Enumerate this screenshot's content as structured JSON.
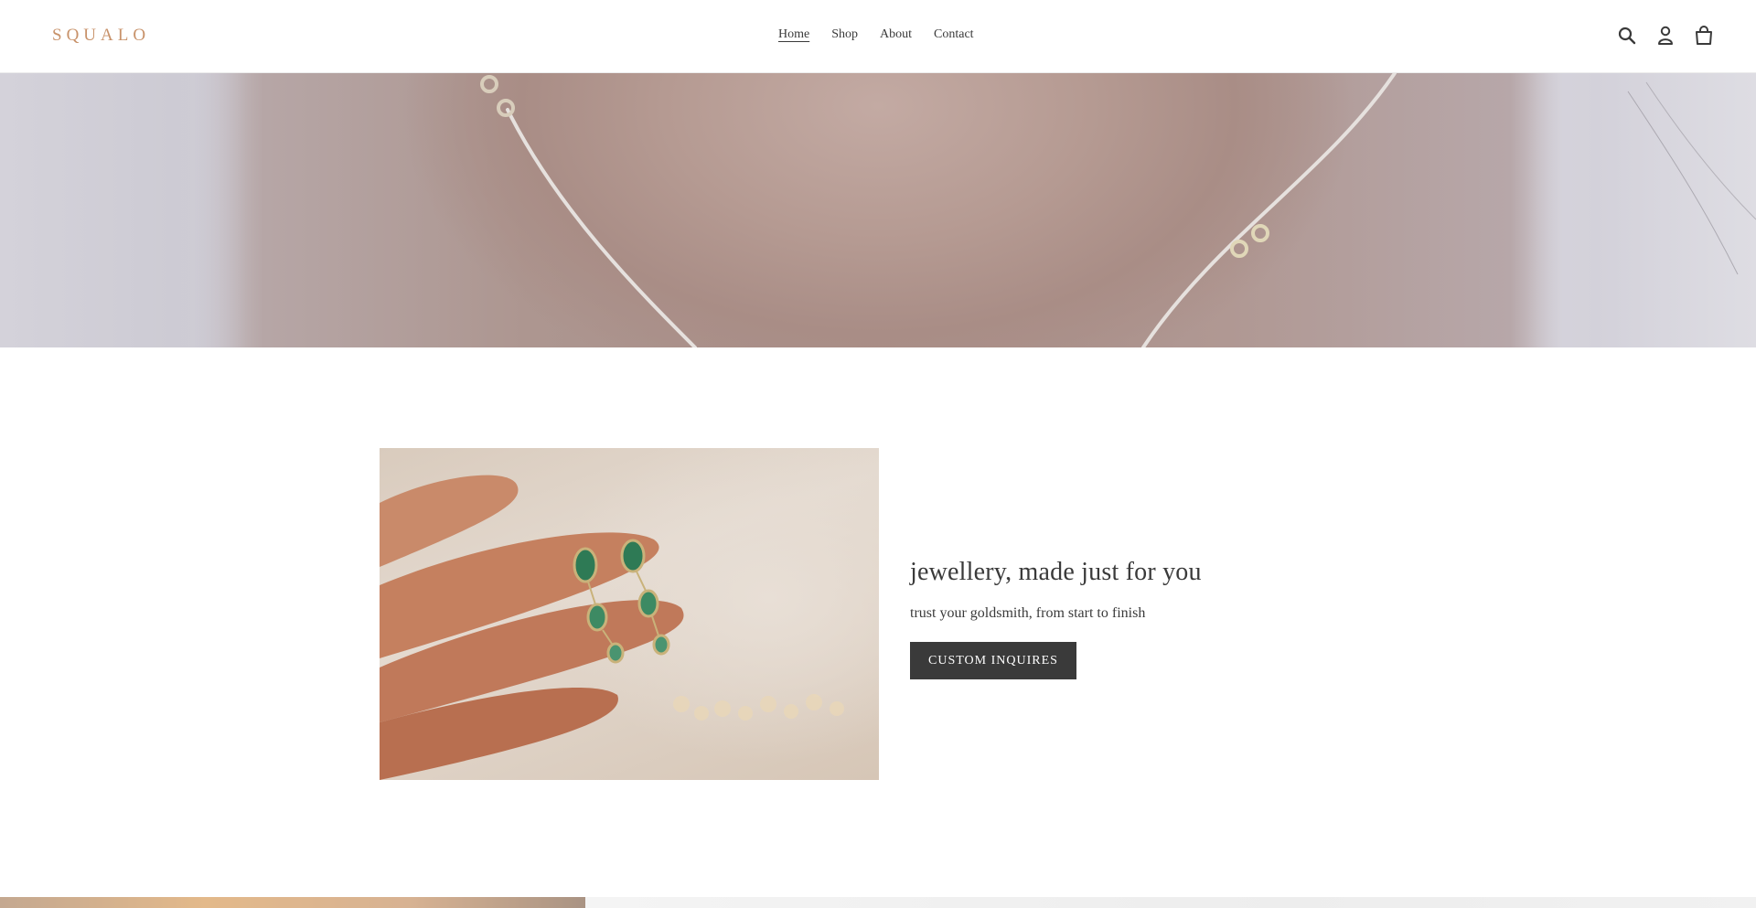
{
  "header": {
    "logo": "SQUALO",
    "nav": [
      {
        "label": "Home",
        "active": true
      },
      {
        "label": "Shop",
        "active": false
      },
      {
        "label": "About",
        "active": false
      },
      {
        "label": "Contact",
        "active": false
      }
    ],
    "icons": [
      "search-icon",
      "account-icon",
      "cart-icon"
    ]
  },
  "feature": {
    "title": "jewellery, made just for you",
    "subtitle": "trust your goldsmith, from start to finish",
    "button_label": "CUSTOM INQUIRES"
  },
  "colors": {
    "logo": "#c8926a",
    "text": "#3a3a3a",
    "button_bg": "#3a3a3a",
    "button_text": "#ffffff"
  }
}
